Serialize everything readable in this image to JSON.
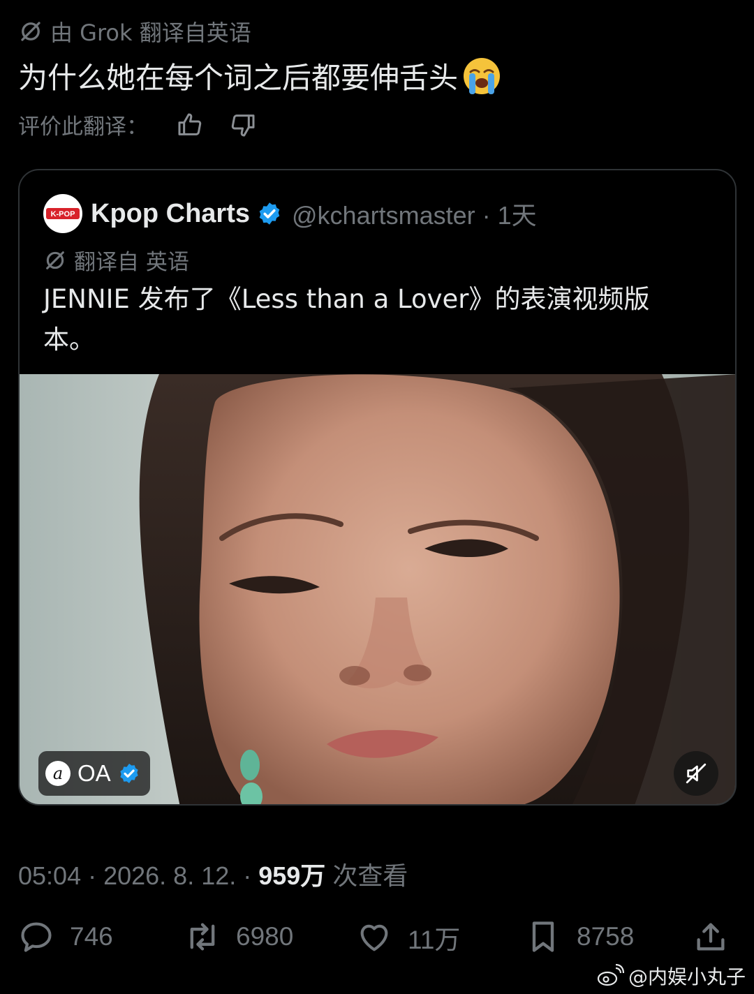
{
  "translation": {
    "source_label": "由 Grok 翻译自英语",
    "text": "为什么她在每个词之后都要伸舌头",
    "rate_label": "评价此翻译："
  },
  "quote": {
    "avatar_text": "K-POP",
    "author": "Kpop Charts",
    "handle_time": "@kchartsmaster · 1天",
    "translated_label": "翻译自 英语",
    "text": "JENNIE 发布了《Less than a Lover》的表演视频版本。",
    "media": {
      "badge_logo": "a",
      "badge_name": "OA"
    }
  },
  "meta": {
    "time_date": "05:04 · 2026. 8. 12. · ",
    "views": "959万",
    "views_suffix": " 次查看"
  },
  "actions": {
    "replies": "746",
    "reposts": "6980",
    "likes": "11万",
    "bookmarks": "8758"
  },
  "watermark": "@内娱小丸子",
  "colors": {
    "background": "#000000",
    "text": "#e7e9ea",
    "muted": "#71767b",
    "verified": "#1d9bf0",
    "border": "#2f3336"
  }
}
